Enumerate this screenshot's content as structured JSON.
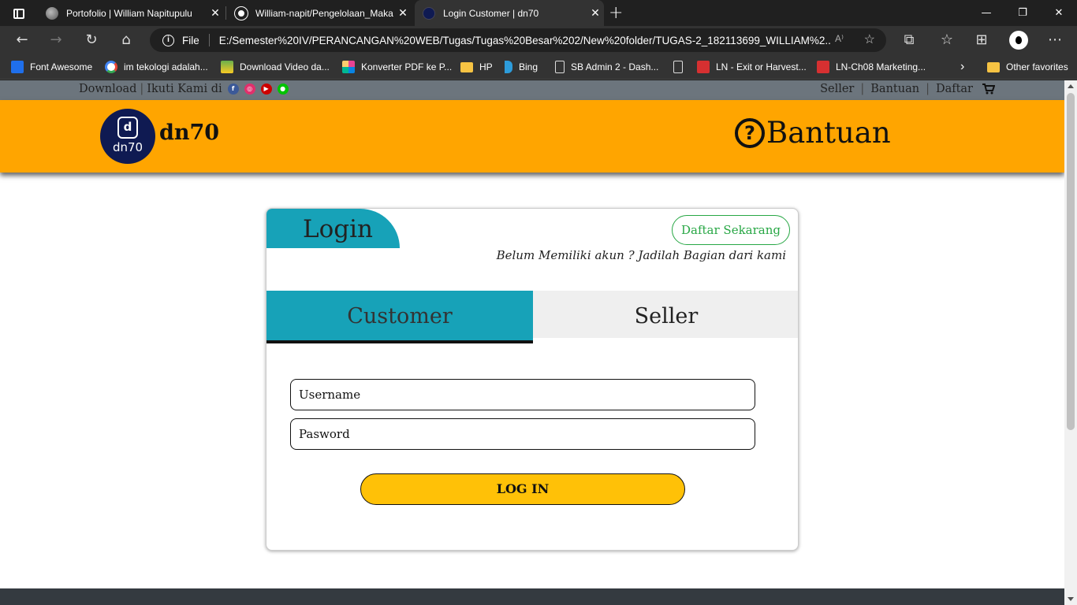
{
  "browser": {
    "tabs": [
      {
        "title": "Portofolio | William Napitupulu",
        "active": false
      },
      {
        "title": "William-napit/Pengelolaan_Maka",
        "active": false
      },
      {
        "title": "Login Customer | dn70",
        "active": true
      }
    ],
    "address": {
      "scheme_label": "File",
      "url": "E:/Semester%20IV/PERANCANGAN%20WEB/Tugas/Tugas%20Besar%202/New%20folder/TUGAS-2_182113699_WILLIAM%2..."
    },
    "bookmarks": [
      {
        "label": "Font Awesome",
        "icon": "flag-icon",
        "color": "#1f6feb"
      },
      {
        "label": "im tekologi adalah...",
        "icon": "google-icon",
        "color": "#ffffff"
      },
      {
        "label": "Download Video da...",
        "icon": "download-icon",
        "color": "#6ab04c"
      },
      {
        "label": "Konverter PDF ke P...",
        "icon": "grid-icon",
        "color": "#e84393"
      },
      {
        "label": "HP",
        "icon": "folder-icon",
        "color": "#f6c343"
      },
      {
        "label": "Bing",
        "icon": "bing-icon",
        "color": "#2d9cdb"
      },
      {
        "label": "SB Admin 2 - Dash...",
        "icon": "page-icon",
        "color": "#dddddd"
      },
      {
        "label": "",
        "icon": "page-icon",
        "color": "#dddddd"
      },
      {
        "label": "LN - Exit or Harvest...",
        "icon": "pdf-icon",
        "color": "#d63031"
      },
      {
        "label": "LN-Ch08 Marketing...",
        "icon": "pdf-icon",
        "color": "#d63031"
      }
    ],
    "other_favorites": "Other favorites"
  },
  "site": {
    "topbar": {
      "download": "Download",
      "follow": "Ikuti Kami di",
      "social": [
        {
          "name": "facebook-icon",
          "glyph": "f",
          "color": "#3b5998"
        },
        {
          "name": "instagram-icon",
          "glyph": "◎",
          "color": "#e1306c"
        },
        {
          "name": "youtube-icon",
          "glyph": "▶",
          "color": "#cc0000"
        },
        {
          "name": "line-icon",
          "glyph": "●",
          "color": "#00c300"
        }
      ],
      "links": [
        "Seller",
        "Bantuan",
        "Daftar"
      ]
    },
    "header": {
      "logo_letter": "d",
      "logo_text": "dn70",
      "brand": "dn70",
      "help_label": "Bantuan"
    },
    "card": {
      "login_title": "Login",
      "signup_button": "Daftar Sekarang",
      "signup_hint": "Belum Memiliki akun ? Jadilah Bagian dari kami",
      "tabs": [
        {
          "label": "Customer",
          "active": true
        },
        {
          "label": "Seller",
          "active": false
        }
      ],
      "username_placeholder": "Username",
      "password_placeholder": "Pasword",
      "login_button": "LOG IN"
    },
    "colors": {
      "accent_orange": "#ffa500",
      "teal": "#17a2b8",
      "login_yellow": "#ffc107",
      "success_green": "#28a745"
    }
  }
}
